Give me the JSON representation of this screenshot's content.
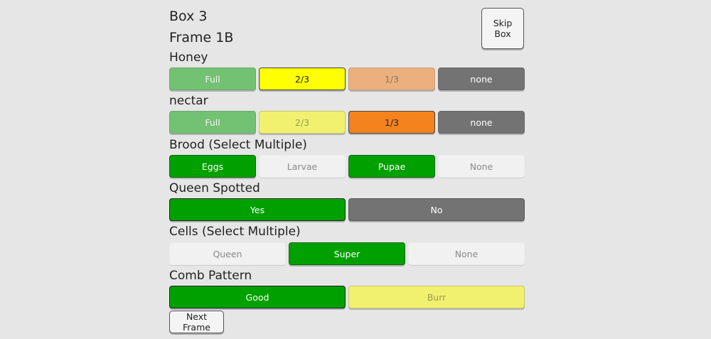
{
  "header": {
    "box_title": "Box 3",
    "frame_title": "Frame 1B",
    "skip_label": "Skip Box"
  },
  "honey": {
    "label": "Honey",
    "options": [
      "Full",
      "2/3",
      "1/3",
      "none"
    ],
    "selected": "2/3"
  },
  "nectar": {
    "label": "nectar",
    "options": [
      "Full",
      "2/3",
      "1/3",
      "none"
    ],
    "selected": "1/3"
  },
  "brood": {
    "label": "Brood (Select Multiple)",
    "options": [
      "Eggs",
      "Larvae",
      "Pupae",
      "None"
    ],
    "selected": [
      "Eggs",
      "Pupae"
    ]
  },
  "queen": {
    "label": "Queen Spotted",
    "options": [
      "Yes",
      "No"
    ],
    "selected": "Yes"
  },
  "cells": {
    "label": "Cells (Select Multiple)",
    "options": [
      "Queen",
      "Super",
      "None"
    ],
    "selected": [
      "Super"
    ]
  },
  "comb": {
    "label": "Comb Pattern",
    "options": [
      "Good",
      "Burr"
    ],
    "selected": "Good"
  },
  "footer": {
    "next_label": "Next Frame"
  },
  "colors": {
    "background": "#e6e6e6",
    "green_selected": "#00a000",
    "green_faded": "#73c173",
    "yellow_selected": "#ffff00",
    "yellow_faded": "#f1f16f",
    "orange_selected": "#f5831d",
    "peach_faded": "#ecb07e",
    "none_gray": "#737373",
    "unselected_light": "#f1f1f1"
  }
}
